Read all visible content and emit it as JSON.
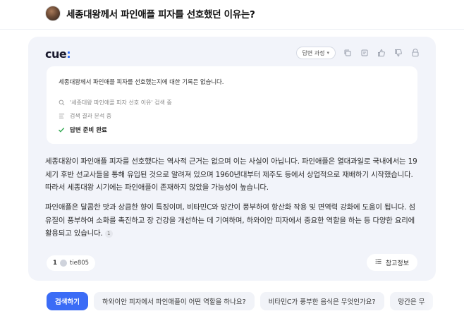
{
  "question": {
    "title": "세종대왕께서 파인애플 피자를 선호했던 이유는?"
  },
  "card": {
    "logo_text": "cue",
    "logo_colon": ":",
    "toolbar": {
      "answer_process_label": "답변 과정",
      "icons": [
        "copy-icon",
        "copy-alt-icon",
        "thumbs-up-icon",
        "thumbs-down-icon",
        "share-icon"
      ]
    },
    "process": {
      "message": "세종대왕께서 파인애플 피자를 선호했는지에 대한 기록은 없습니다.",
      "steps": [
        {
          "icon": "search-icon",
          "text": "'세종대왕 파인애플 피자 선호 이유' 검색 중"
        },
        {
          "icon": "list-icon",
          "text": "검색 결과 분석 중"
        },
        {
          "icon": "check-icon",
          "text": "답변 준비 완료"
        }
      ]
    },
    "answer": {
      "paragraph1": "세종대왕이 파인애플 피자를 선호했다는 역사적 근거는 없으며 이는 사실이 아닙니다. 파인애플은 열대과일로 국내에서는 19세기 후반 선교사들을 통해 유입된 것으로 알려져 있으며 1960년대부터 제주도 등에서 상업적으로 재배하기 시작했습니다. 따라서 세종대왕 시기에는 파인애플이 존재하지 않았을 가능성이 높습니다.",
      "paragraph2": "파인애플은 달콤한 맛과 상큼한 향이 특징이며, 비타민C와 망간이 풍부하여 항산화 작용 및 면역력 강화에 도움이 됩니다. 섬유질이 풍부하여 소화를 촉진하고 장 건강을 개선하는 데 기여하며, 하와이안 피자에서 중요한 역할을 하는 등 다양한 요리에 활용되고 있습니다.",
      "citation": "1"
    },
    "source": {
      "count": "1",
      "name": "tie805"
    },
    "references_label": "참고정보"
  },
  "suggestions": {
    "search_label": "검색하기",
    "items": [
      "하와이안 피자에서 파인애플이 어떤 역할을 하나요?",
      "비타민C가 풍부한 음식은 무엇인가요?",
      "망간은 무"
    ]
  },
  "colors": {
    "accent": "#3b6cf6",
    "card_bg": "#f2f4fa",
    "check": "#2fa84f"
  }
}
